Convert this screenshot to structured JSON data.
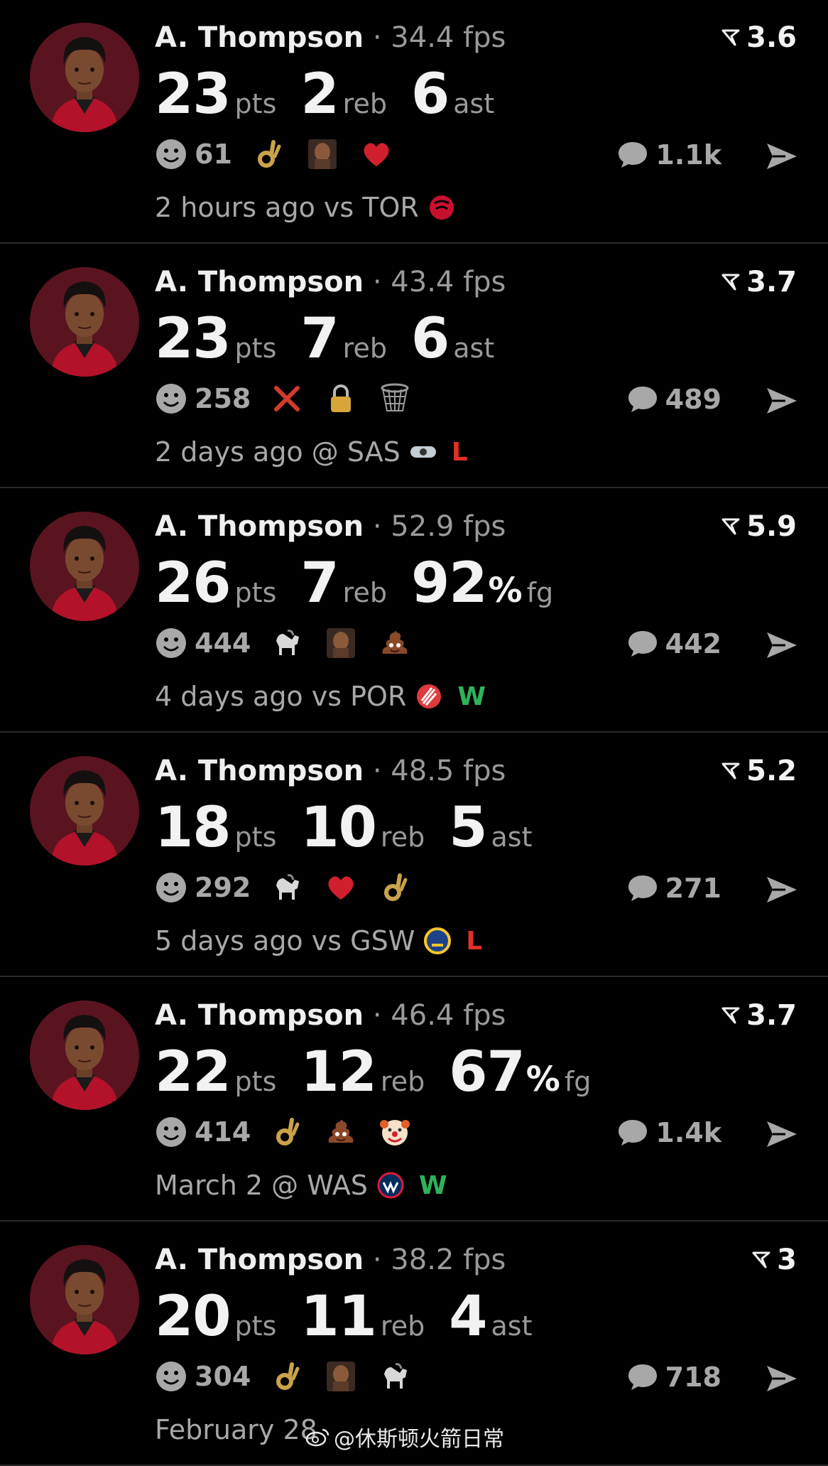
{
  "colors": {
    "background": "#000000",
    "loss": "#e0302a",
    "win": "#2fb35a",
    "muted": "#9a9a9a"
  },
  "posts": [
    {
      "name": "A. Thompson",
      "fps": "· 34.4 fps",
      "rating": "3.6",
      "stats": [
        {
          "value": "23",
          "unit": "pts"
        },
        {
          "value": "2",
          "unit": "reb"
        },
        {
          "value": "6",
          "unit": "ast"
        }
      ],
      "reactions": "61",
      "emojis": [
        "ok-hand-icon",
        "face-photo-icon",
        "heart-icon"
      ],
      "comments": "1.1k",
      "game": "2 hours ago vs TOR",
      "team_logo": "raptors-logo-icon",
      "result": ""
    },
    {
      "name": "A. Thompson",
      "fps": "· 43.4 fps",
      "rating": "3.7",
      "stats": [
        {
          "value": "23",
          "unit": "pts"
        },
        {
          "value": "7",
          "unit": "reb"
        },
        {
          "value": "6",
          "unit": "ast"
        }
      ],
      "reactions": "258",
      "emojis": [
        "cross-mark-icon",
        "lock-icon",
        "basketball-net-icon"
      ],
      "comments": "489",
      "game": "2 days ago @ SAS",
      "team_logo": "spurs-logo-icon",
      "result": "L"
    },
    {
      "name": "A. Thompson",
      "fps": "· 52.9 fps",
      "rating": "5.9",
      "stats": [
        {
          "value": "26",
          "unit": "pts"
        },
        {
          "value": "7",
          "unit": "reb"
        },
        {
          "value": "92",
          "pct": "%",
          "unit": "fg"
        }
      ],
      "reactions": "444",
      "emojis": [
        "goat-icon",
        "face-photo-icon",
        "poop-icon"
      ],
      "comments": "442",
      "game": "4 days ago vs POR",
      "team_logo": "blazers-logo-icon",
      "result": "W"
    },
    {
      "name": "A. Thompson",
      "fps": "· 48.5 fps",
      "rating": "5.2",
      "stats": [
        {
          "value": "18",
          "unit": "pts"
        },
        {
          "value": "10",
          "unit": "reb"
        },
        {
          "value": "5",
          "unit": "ast"
        }
      ],
      "reactions": "292",
      "emojis": [
        "goat-icon",
        "heart-icon",
        "ok-hand-icon"
      ],
      "comments": "271",
      "game": "5 days ago vs GSW",
      "team_logo": "warriors-logo-icon",
      "result": "L"
    },
    {
      "name": "A. Thompson",
      "fps": "· 46.4 fps",
      "rating": "3.7",
      "stats": [
        {
          "value": "22",
          "unit": "pts"
        },
        {
          "value": "12",
          "unit": "reb"
        },
        {
          "value": "67",
          "pct": "%",
          "unit": "fg"
        }
      ],
      "reactions": "414",
      "emojis": [
        "ok-hand-icon",
        "poop-icon",
        "clown-icon"
      ],
      "comments": "1.4k",
      "game": "March 2 @ WAS",
      "team_logo": "wizards-logo-icon",
      "result": "W"
    },
    {
      "name": "A. Thompson",
      "fps": "· 38.2 fps",
      "rating": "3",
      "stats": [
        {
          "value": "20",
          "unit": "pts"
        },
        {
          "value": "11",
          "unit": "reb"
        },
        {
          "value": "4",
          "unit": "ast"
        }
      ],
      "reactions": "304",
      "emojis": [
        "ok-hand-icon",
        "face-photo-icon",
        "goat-icon"
      ],
      "comments": "718",
      "game": "February 28",
      "team_logo": "",
      "result": ""
    }
  ],
  "watermark": "@休斯顿火箭日常"
}
